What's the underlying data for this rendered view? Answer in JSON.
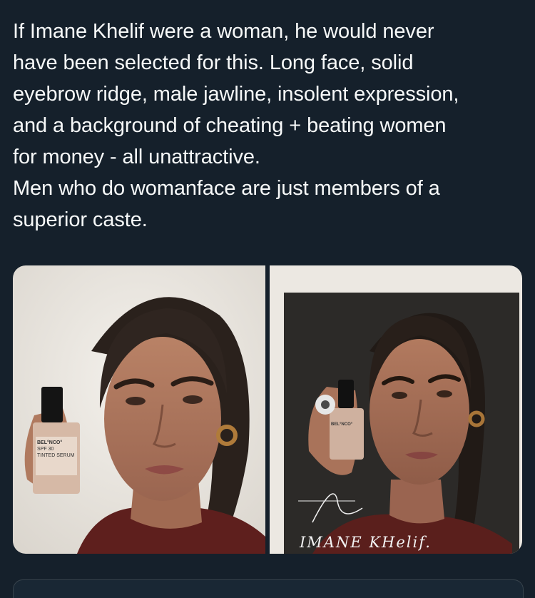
{
  "tweet": {
    "lines": [
      "If Imane Khelif were a woman, he would never",
      "have been selected for this. Long face, solid",
      "eyebrow ridge, male jawline, insolent expression,",
      "and a background of cheating + beating women",
      "for money - all unattractive.",
      "Men who do womanface are just members of a",
      "superior caste."
    ]
  },
  "media": {
    "photo_left": {
      "product_brand": "BEL°NCO°",
      "product_name": "TINTED SERUM",
      "spf": "SPF 30"
    },
    "photo_right": {
      "product_brand": "BEL°NCO°",
      "signature": "IMANE KHelif."
    }
  },
  "colors": {
    "background": "#15202b",
    "text": "#f7f9f9",
    "border": "#38444d"
  }
}
